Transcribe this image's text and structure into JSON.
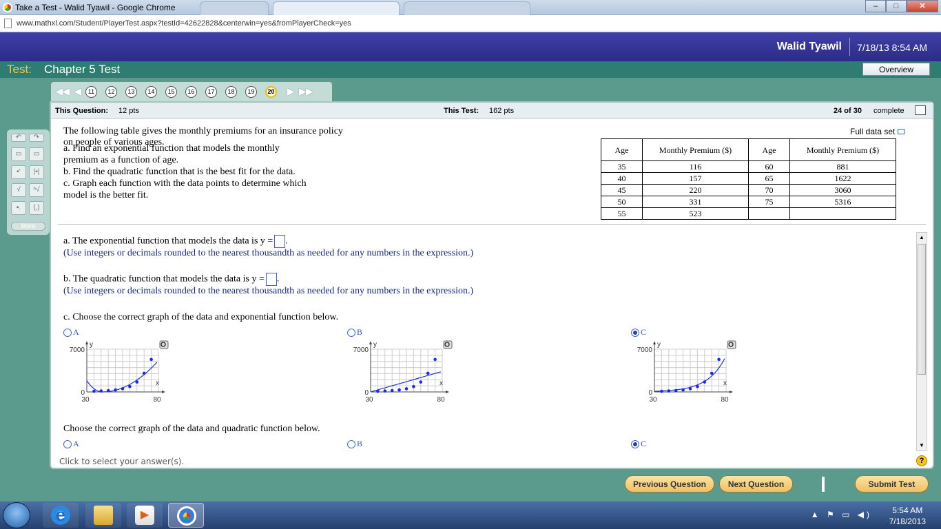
{
  "browser": {
    "title": "Take a Test - Walid Tyawil - Google Chrome",
    "url": "www.mathxl.com/Student/PlayerTest.aspx?testId=42622828&centerwin=yes&fromPlayerCheck=yes",
    "buttons": {
      "minimize": "–",
      "maximize": "□",
      "close": "✕"
    }
  },
  "header": {
    "user": "Walid Tyawil",
    "datetime": "7/18/13 8:54 AM"
  },
  "testbar": {
    "label": "Test:",
    "name": "Chapter 5 Test",
    "overview": "Overview"
  },
  "nav": {
    "first": "◀◀",
    "prev": "◀",
    "next": "▶",
    "last": "▶▶",
    "questions": [
      "11",
      "12",
      "13",
      "14",
      "15",
      "16",
      "17",
      "18",
      "19",
      "20"
    ],
    "current": "20"
  },
  "info": {
    "this_question_label": "This Question:",
    "this_question_value": "12 pts",
    "this_test_label": "This Test:",
    "this_test_value": "162 pts",
    "progress": "24 of 30",
    "progress_suffix": "complete"
  },
  "toolbox": {
    "more": "More"
  },
  "question": {
    "intro": "The following table gives the monthly premiums for an insurance policy on people of various ages.",
    "task_a": "a. Find an exponential function that models the monthly premium as a function of age.",
    "task_b": "b. Find the quadratic function that is the best fit for the data.",
    "task_c": "c. Graph each function with the data points to determine which model is the better fit.",
    "full_data_set": "Full data set"
  },
  "table": {
    "headers": [
      "Age",
      "Monthly Premium ($)",
      "Age",
      "Monthly Premium ($)"
    ],
    "rows": [
      [
        "35",
        "116",
        "60",
        "881"
      ],
      [
        "40",
        "157",
        "65",
        "1622"
      ],
      [
        "45",
        "220",
        "70",
        "3060"
      ],
      [
        "50",
        "331",
        "75",
        "5316"
      ],
      [
        "55",
        "523",
        "",
        ""
      ]
    ]
  },
  "answers": {
    "a_text": "a. The exponential function that models the data is y =",
    "a_hint": "(Use integers or decimals rounded to the nearest thousandth as needed for any numbers in the expression.)",
    "b_text": "b. The quadratic function that models the data is y =",
    "b_hint": "(Use integers or decimals rounded to the nearest thousandth as needed for any numbers in the expression.)",
    "c_text": "c. Choose the correct graph of the data and exponential function below.",
    "quad_text": "Choose the correct graph of the data and quadratic function below.",
    "options": [
      "A",
      "B",
      "C"
    ],
    "selected_exponential": "C",
    "selected_quadratic": "C"
  },
  "graph_labels": {
    "y": "y",
    "x": "x",
    "ymax": "7000",
    "ymin": "0",
    "xmin": "30",
    "xmax": "80"
  },
  "chart_data": [
    {
      "type": "scatter",
      "name": "A",
      "x": [
        35,
        40,
        45,
        50,
        55,
        60,
        65,
        70,
        75
      ],
      "y": [
        116,
        157,
        220,
        331,
        523,
        881,
        1622,
        3060,
        5316
      ],
      "curve": "u-shape fit",
      "xlim": [
        30,
        80
      ],
      "ylim": [
        0,
        7000
      ]
    },
    {
      "type": "scatter",
      "name": "B",
      "x": [
        35,
        40,
        45,
        50,
        55,
        60,
        65,
        70,
        75
      ],
      "y": [
        116,
        157,
        220,
        331,
        523,
        881,
        1622,
        3060,
        5316
      ],
      "curve": "slowly increasing fit",
      "xlim": [
        30,
        80
      ],
      "ylim": [
        0,
        7000
      ]
    },
    {
      "type": "scatter",
      "name": "C",
      "x": [
        35,
        40,
        45,
        50,
        55,
        60,
        65,
        70,
        75
      ],
      "y": [
        116,
        157,
        220,
        331,
        523,
        881,
        1622,
        3060,
        5316
      ],
      "curve": "exponential fit",
      "xlim": [
        30,
        80
      ],
      "ylim": [
        0,
        7000
      ]
    }
  ],
  "status": "Click to select your answer(s).",
  "footer": {
    "previous": "Previous Question",
    "next": "Next Question",
    "submit": "Submit Test"
  },
  "taskbar": {
    "time": "5:54 AM",
    "date": "7/18/2013",
    "tray": "▲ ⚑ ▭ ◀)"
  }
}
